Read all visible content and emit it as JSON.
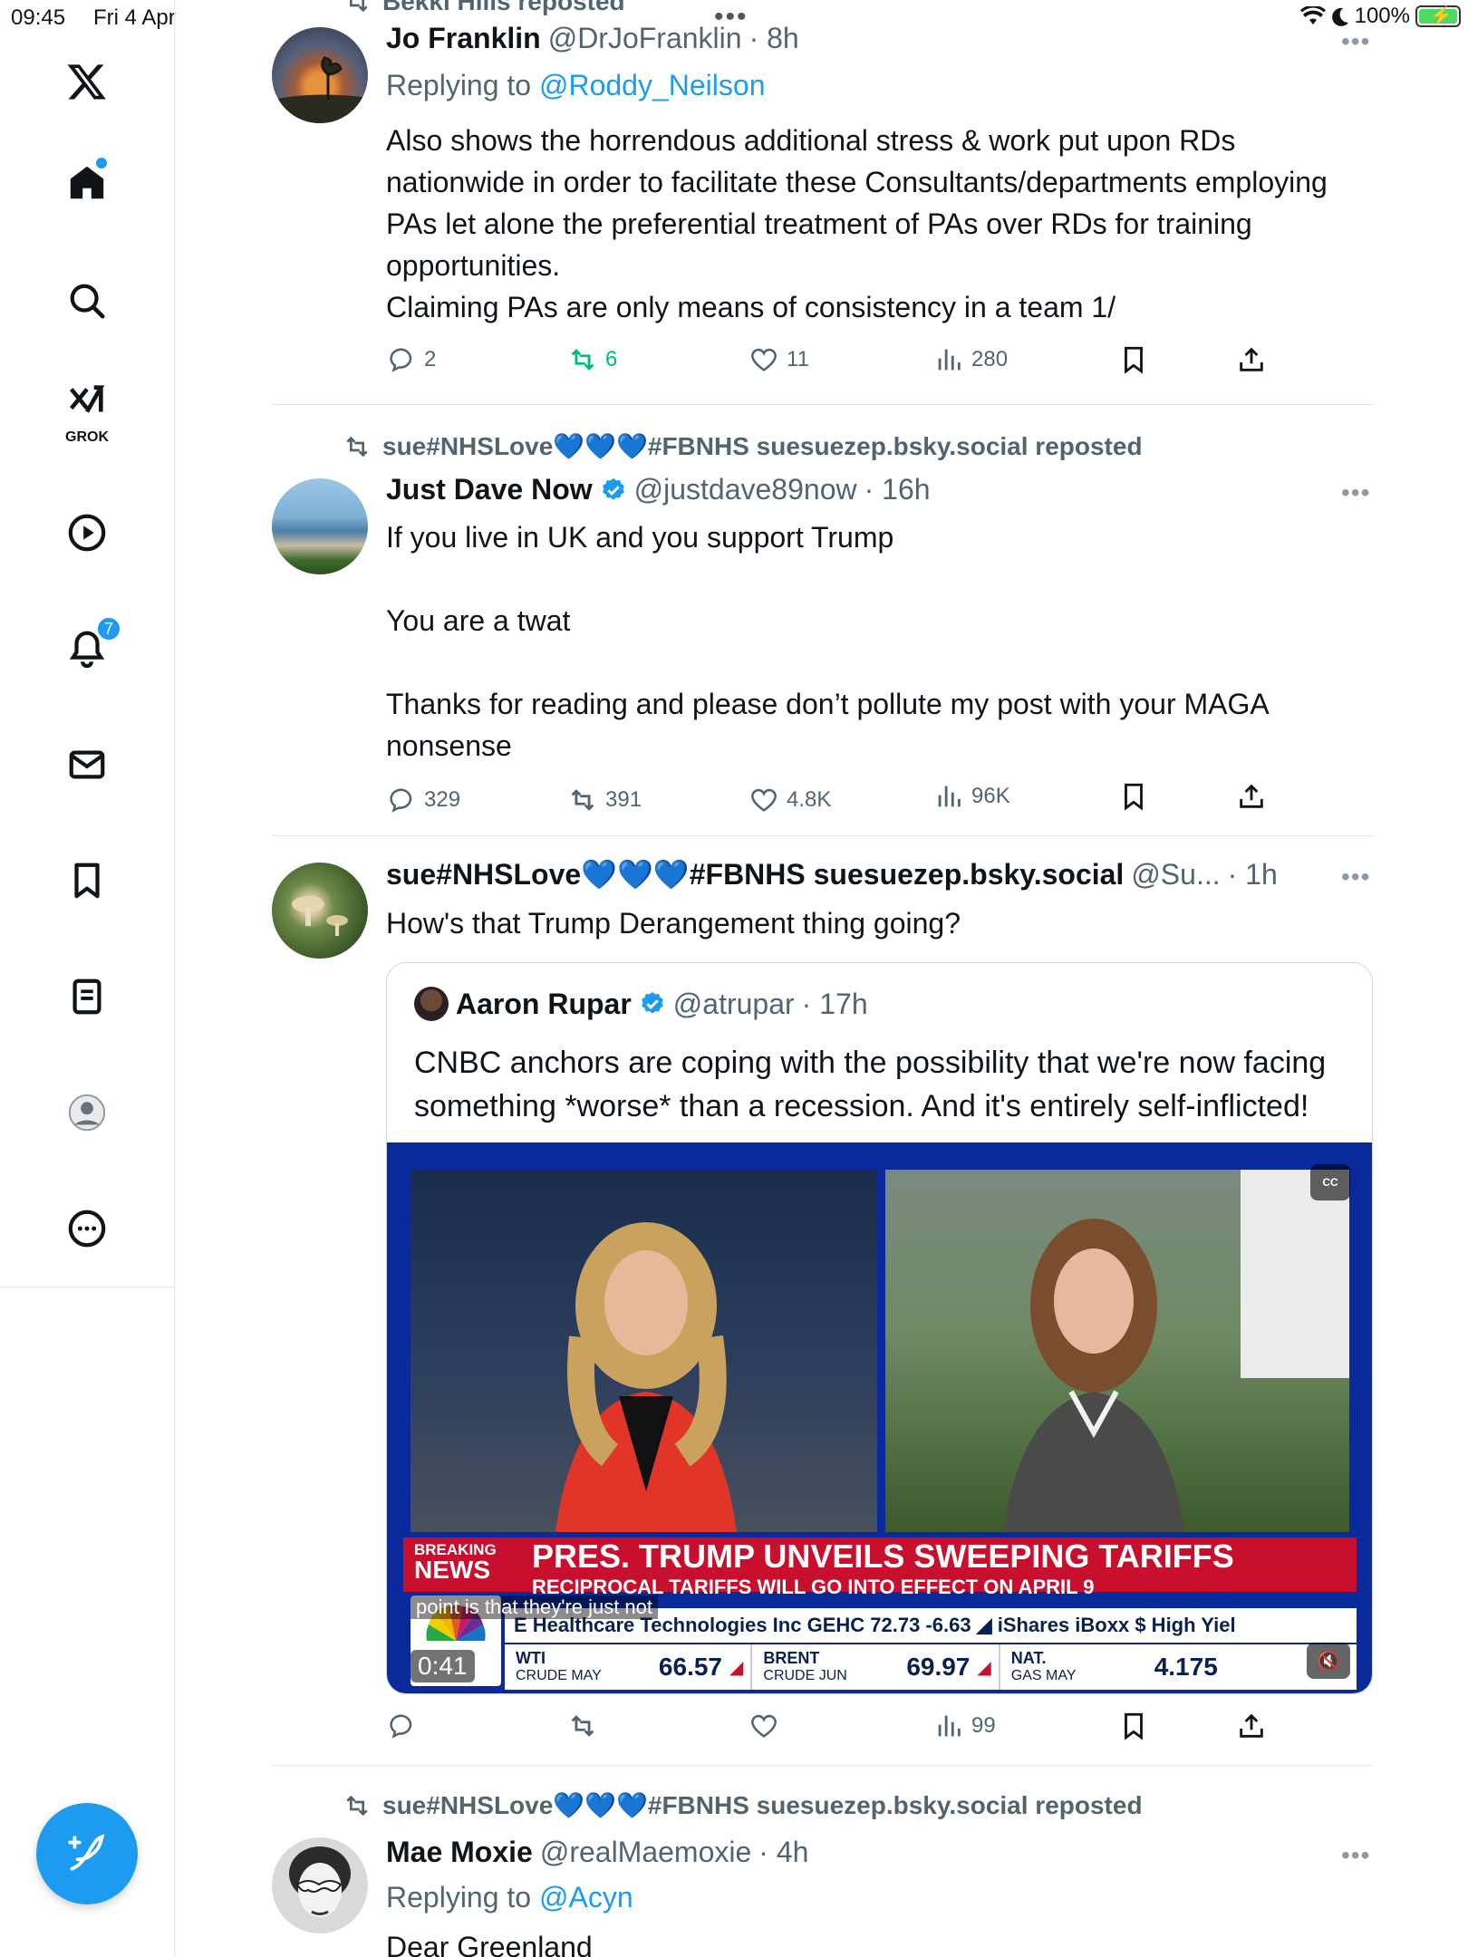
{
  "status_bar": {
    "time": "09:45",
    "date": "Fri 4 Apr",
    "battery": "100%",
    "battery_level": 1.0
  },
  "nav": {
    "grok_label": "GROK",
    "notifications_badge": "7"
  },
  "top_partial": {
    "reposted_by": "Bekki Hills reposted"
  },
  "tweets": [
    {
      "name": "Jo Franklin",
      "handle": "@DrJoFranklin",
      "time": "· 8h",
      "replying_label": "Replying to",
      "replying_to": "@Roddy_Neilson",
      "text": "Also shows the horrendous additional stress & work put upon RDs nationwide in order to facilitate these Consultants/departments employing PAs let alone the preferential treatment of PAs over RDs for training opportunities.\nClaiming PAs are only means of consistency in a team 1/",
      "replies": "2",
      "reposts": "6",
      "likes": "11",
      "views": "280"
    },
    {
      "reposted_by": "sue#NHSLove💙💙💙#FBNHS suesuezep.bsky.social reposted",
      "name": "Just Dave Now",
      "verified": true,
      "handle": "@justdave89now",
      "time": "· 16h",
      "text": "If you live in UK and you support Trump\n\nYou are a twat\n\nThanks for reading and please don’t pollute my post with your MAGA nonsense",
      "replies": "329",
      "reposts": "391",
      "likes": "4.8K",
      "views": "96K"
    },
    {
      "name": "sue#NHSLove💙💙💙#FBNHS suesuezep.bsky.social",
      "handle": "@Su...",
      "time": "· 1h",
      "text": "How's that Trump Derangement thing going?",
      "views": "99",
      "quote": {
        "name": "Aaron Rupar",
        "verified": true,
        "handle": "@atrupar",
        "time": "· 17h",
        "text": "CNBC anchors are coping with the possibility that we're now facing something *worse* than a recession. And it's entirely self-inflicted!",
        "video": {
          "breaking": "BREAKING",
          "news": "NEWS",
          "headline": "PRES. TRUMP UNVEILS SWEEPING TARIFFS",
          "subline": "RECIPROCAL TARIFFS WILL GO INTO EFFECT ON APRIL 9",
          "crawl": "E Healthcare Technologies Inc GEHC 72.73 -6.63 ◢    iShares iBoxx $ High Yiel",
          "caption": "point is that they're just not",
          "timecode": "0:41",
          "cc": "CC",
          "markets": [
            {
              "label": "WTI",
              "sub": "CRUDE MAY",
              "value": "66.57"
            },
            {
              "label": "BRENT",
              "sub": "CRUDE JUN",
              "value": "69.97"
            },
            {
              "label": "NAT.",
              "sub": "GAS MAY",
              "value": "4.175"
            }
          ]
        }
      }
    },
    {
      "reposted_by": "sue#NHSLove💙💙💙#FBNHS suesuezep.bsky.social reposted",
      "name": "Mae Moxie",
      "handle": "@realMaemoxie",
      "time": "· 4h",
      "replying_label": "Replying to",
      "replying_to": "@Acyn",
      "text": "Dear Greenland"
    }
  ],
  "colors": {
    "accent": "#1d9bf0",
    "repost_green": "#00ba7c",
    "muted": "#536471",
    "cnbc_red": "#c8102e",
    "cnbc_blue": "#0a2a9c"
  },
  "icons": [
    "x-logo-icon",
    "home-icon",
    "search-icon",
    "grok-icon",
    "video-icon",
    "bell-icon",
    "mail-icon",
    "bookmark-icon",
    "lists-icon",
    "profile-icon",
    "more-icon",
    "compose-icon",
    "reply-icon",
    "repost-icon",
    "like-icon",
    "views-icon",
    "share-icon",
    "verified-icon"
  ]
}
